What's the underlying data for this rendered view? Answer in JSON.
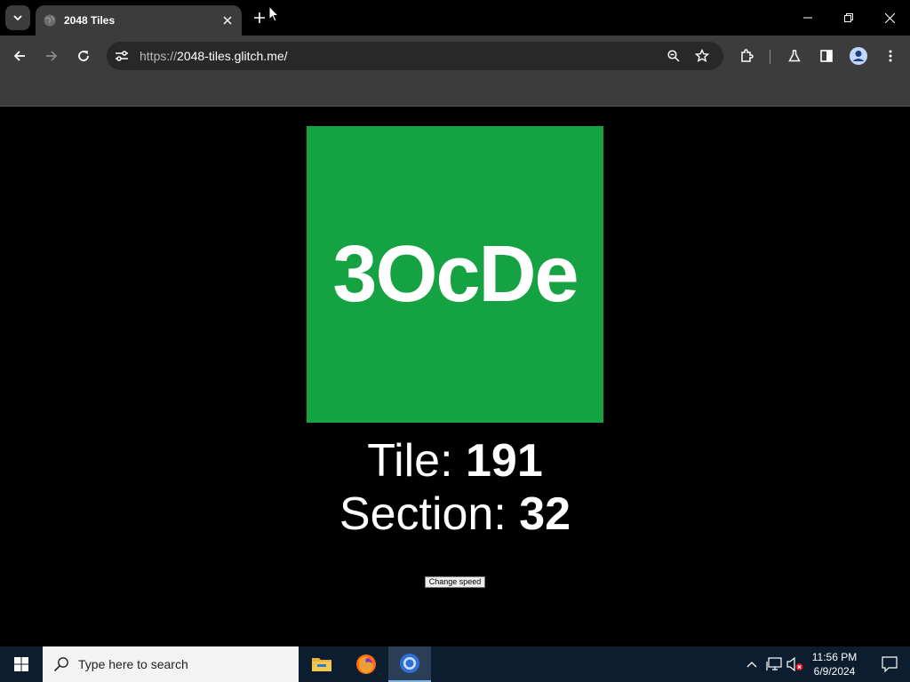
{
  "browser": {
    "tab_title": "2048 Tiles",
    "url_scheme": "https://",
    "url_host": "2048-tiles.glitch.me/"
  },
  "page": {
    "tile_text": "3OcDe",
    "tile_color": "#15a243",
    "tile_label": "Tile: ",
    "tile_value": "191",
    "section_label": "Section: ",
    "section_value": "32",
    "speed_button": "Change speed"
  },
  "taskbar": {
    "search_placeholder": "Type here to search",
    "time": "11:56 PM",
    "date": "6/9/2024"
  },
  "icons": [
    "tab-search-icon",
    "globe-icon",
    "close-icon",
    "plus-icon",
    "minimize-icon",
    "restore-icon",
    "back-icon",
    "forward-icon",
    "reload-icon",
    "site-info-icon",
    "zoom-icon",
    "star-icon",
    "extensions-icon",
    "labs-icon",
    "side-panel-icon",
    "profile-icon",
    "menu-icon",
    "windows-icon",
    "search-icon",
    "file-explorer-icon",
    "firefox-icon",
    "chrome-icon",
    "chevron-up-icon",
    "network-icon",
    "volume-muted-icon",
    "notification-icon"
  ]
}
